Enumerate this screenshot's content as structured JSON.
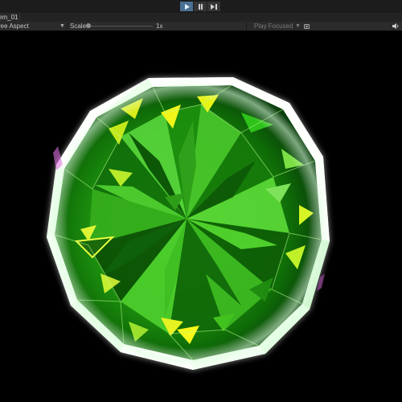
{
  "tab": {
    "title": "em_01"
  },
  "toolbar": {
    "aspect_label": "ree Aspect",
    "scale_label": "Scale",
    "scale_value": "1x",
    "play_focused": "Play Focused"
  },
  "playback": {
    "play_active": true
  },
  "icons": [
    "play-icon",
    "pause-icon",
    "step-icon",
    "chevron-down-icon",
    "camera-icon",
    "speaker-icon"
  ],
  "colors": {
    "accent": "#4a6f93",
    "gem_dark": "#0b3d05",
    "gem_mid": "#2fb515",
    "gem_bright": "#b9ff4a",
    "gem_yellow": "#e9f20c",
    "glow": "#ffffff"
  }
}
